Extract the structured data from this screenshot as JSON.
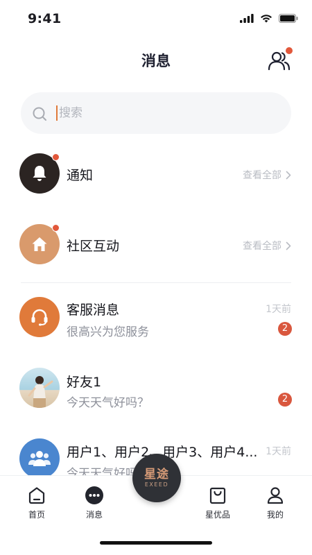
{
  "status": {
    "time": "9:41"
  },
  "header": {
    "title": "消息"
  },
  "search": {
    "placeholder": "搜索"
  },
  "rows": [
    {
      "title": "通知",
      "link": "查看全部",
      "unread_dot": true,
      "icon": "bell-icon"
    },
    {
      "title": "社区互动",
      "link": "查看全部",
      "unread_dot": true,
      "icon": "home-icon"
    },
    {
      "title": "客服消息",
      "subtitle": "很高兴为您服务",
      "time": "1天前",
      "badge": "2",
      "icon": "headset-icon"
    },
    {
      "title": "好友1",
      "subtitle": "今天天气好吗？",
      "badge": "2",
      "icon": "friend-photo"
    },
    {
      "title": "用户1、用户2、用户3、用户4...",
      "subtitle": "今天天气好吗？",
      "time": "1天前",
      "icon": "group-icon"
    }
  ],
  "tabbar": {
    "items": [
      {
        "label": "首页",
        "icon": "home-tab-icon"
      },
      {
        "label": "消息",
        "icon": "chat-dots-icon"
      },
      {
        "label": "星优品",
        "icon": "shopping-bag-icon"
      },
      {
        "label": "我的",
        "icon": "person-icon"
      }
    ],
    "center": {
      "logo_cn": "星途",
      "logo_en": "EXEED"
    }
  },
  "colors": {
    "accent_red": "#e2583b",
    "brand_dark": "#2f3136",
    "service_orange": "#e07a3a",
    "community_tan": "#d99a6c"
  }
}
